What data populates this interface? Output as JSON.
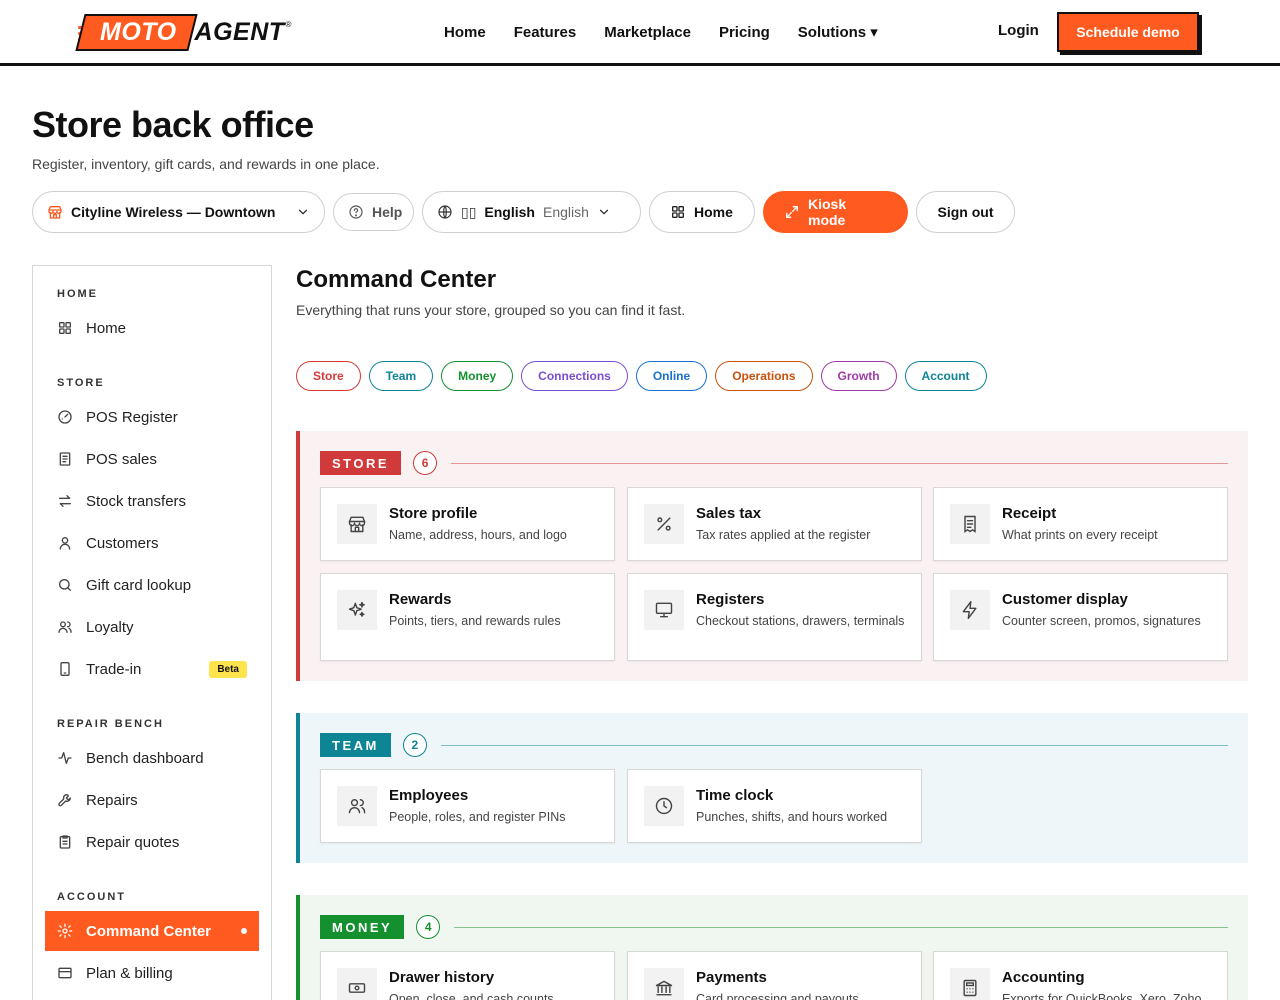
{
  "brand": {
    "part1": "MOTO",
    "part2": "AGENT",
    "reg": "®",
    "accent": "#ff5a1f"
  },
  "nav": {
    "links": [
      "Home",
      "Features",
      "Marketplace",
      "Pricing",
      "Solutions ▾"
    ],
    "login": "Login",
    "cta": "Schedule demo"
  },
  "header": {
    "title": "Store back office",
    "subtitle": "Register, inventory, gift cards, and rewards in one place."
  },
  "toolbar": {
    "store": "Cityline Wireless — Downtown",
    "help": "Help",
    "lang_flag": "▯▯",
    "lang_label": "English",
    "lang_value": "English",
    "home": "Home",
    "kiosk": "Kiosk mode",
    "signout": "Sign out"
  },
  "sidebar": {
    "sections": [
      {
        "label": "HOME",
        "items": [
          {
            "label": "Home",
            "icon": "grid-icon"
          }
        ]
      },
      {
        "label": "STORE",
        "items": [
          {
            "label": "POS Register",
            "icon": "gauge-icon"
          },
          {
            "label": "POS sales",
            "icon": "document-icon"
          },
          {
            "label": "Stock transfers",
            "icon": "transfer-icon"
          },
          {
            "label": "Customers",
            "icon": "user-icon"
          },
          {
            "label": "Gift card lookup",
            "icon": "search-icon"
          },
          {
            "label": "Loyalty",
            "icon": "users-icon"
          },
          {
            "label": "Trade-in",
            "icon": "phone-icon",
            "badge": "Beta"
          }
        ]
      },
      {
        "label": "REPAIR BENCH",
        "items": [
          {
            "label": "Bench dashboard",
            "icon": "activity-icon"
          },
          {
            "label": "Repairs",
            "icon": "wrench-icon"
          },
          {
            "label": "Repair quotes",
            "icon": "clipboard-icon"
          }
        ]
      },
      {
        "label": "ACCOUNT",
        "items": [
          {
            "label": "Command Center",
            "icon": "gear-icon",
            "active": true
          },
          {
            "label": "Plan & billing",
            "icon": "card-icon"
          }
        ]
      }
    ]
  },
  "main": {
    "title": "Command Center",
    "subtitle": "Everything that runs your store, grouped so you can find it fast.",
    "chips": [
      {
        "label": "Store",
        "color": "#d43a3a"
      },
      {
        "label": "Team",
        "color": "#0e8595"
      },
      {
        "label": "Money",
        "color": "#15902f"
      },
      {
        "label": "Connections",
        "color": "#7a4ed3"
      },
      {
        "label": "Online",
        "color": "#1a6fd1"
      },
      {
        "label": "Operations",
        "color": "#c9510c"
      },
      {
        "label": "Growth",
        "color": "#a03aa6"
      },
      {
        "label": "Account",
        "color": "#0e8595"
      }
    ],
    "groups": [
      {
        "tag": "STORE",
        "count": "6",
        "color": "#d13a3a",
        "bg": "#faf2f2",
        "cards": [
          {
            "title": "Store profile",
            "desc": "Name, address, hours, and logo",
            "icon": "storefront-icon"
          },
          {
            "title": "Sales tax",
            "desc": "Tax rates applied at the register",
            "icon": "percent-icon"
          },
          {
            "title": "Receipt",
            "desc": "What prints on every receipt",
            "icon": "receipt-icon"
          },
          {
            "title": "Rewards",
            "desc": "Points, tiers, and rewards rules",
            "icon": "sparkles-icon"
          },
          {
            "title": "Registers",
            "desc": "Checkout stations, drawers, terminals",
            "icon": "monitor-icon"
          },
          {
            "title": "Customer display",
            "desc": "Counter screen, promos, signatures",
            "icon": "bolt-icon"
          }
        ]
      },
      {
        "tag": "TEAM",
        "count": "2",
        "color": "#0e8595",
        "bg": "#eef6f9",
        "cards": [
          {
            "title": "Employees",
            "desc": "People, roles, and register PINs",
            "icon": "users-icon"
          },
          {
            "title": "Time clock",
            "desc": "Punches, shifts, and hours worked",
            "icon": "clock-icon"
          }
        ]
      },
      {
        "tag": "MONEY",
        "count": "4",
        "color": "#15902f",
        "bg": "#eff7f0",
        "cards": [
          {
            "title": "Drawer history",
            "desc": "Open, close, and cash counts",
            "icon": "cash-icon"
          },
          {
            "title": "Payments",
            "desc": "Card processing and payouts",
            "icon": "bank-icon"
          },
          {
            "title": "Accounting",
            "desc": "Exports for QuickBooks, Xero, Zoho",
            "icon": "calculator-icon"
          }
        ]
      }
    ]
  }
}
